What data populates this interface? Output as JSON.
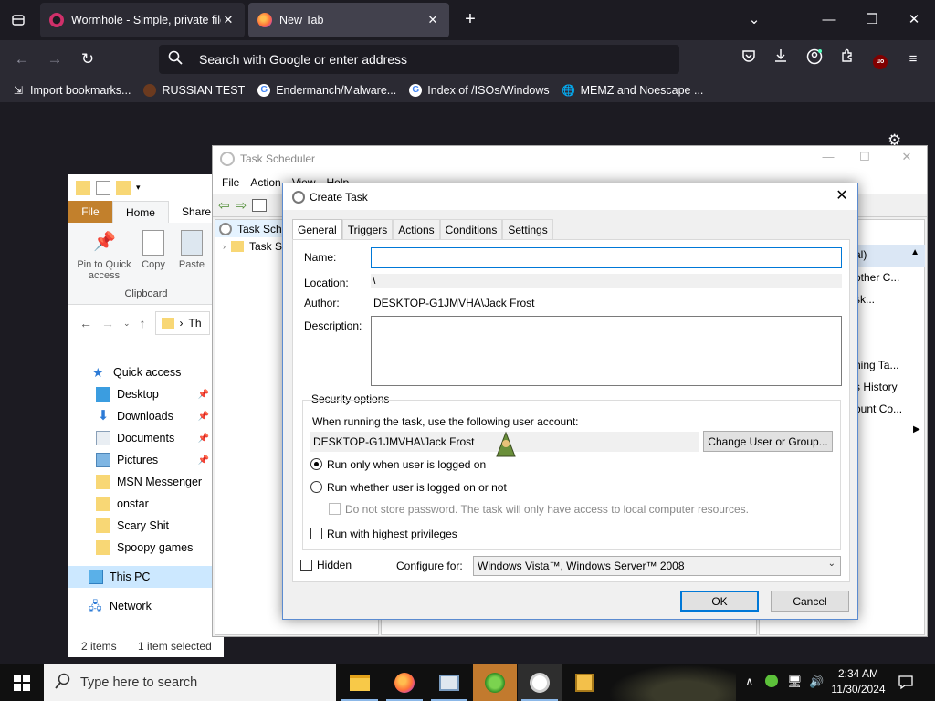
{
  "browser": {
    "tabs": [
      {
        "title": "Wormhole - Simple, private file",
        "active": false
      },
      {
        "title": "New Tab",
        "active": true
      }
    ],
    "urlbar_placeholder": "Search with Google or enter address",
    "bookmarks": [
      {
        "label": "Import bookmarks...",
        "icon": "import-icon"
      },
      {
        "label": "RUSSIAN TEST",
        "icon": "russian-test-icon"
      },
      {
        "label": "Endermanch/Malware...",
        "icon": "google-icon"
      },
      {
        "label": "Index of /ISOs/Windows",
        "icon": "google-icon"
      },
      {
        "label": "MEMZ and Noescape ...",
        "icon": "globe-icon"
      }
    ],
    "colors": {
      "tabbar": "#1c1b22",
      "toolbar": "#2b2a33",
      "active_tab": "#42414d"
    }
  },
  "explorer": {
    "ribbon_tabs": [
      "File",
      "Home",
      "Share"
    ],
    "ribbon_buttons": [
      {
        "label": "Pin to Quick access"
      },
      {
        "label": "Copy"
      },
      {
        "label": "Paste"
      }
    ],
    "ribbon_group": "Clipboard",
    "address_crumb": "Th",
    "nav": [
      {
        "label": "Quick access",
        "pinned": false
      },
      {
        "label": "Desktop",
        "pinned": true
      },
      {
        "label": "Downloads",
        "pinned": true
      },
      {
        "label": "Documents",
        "pinned": true
      },
      {
        "label": "Pictures",
        "pinned": true
      },
      {
        "label": "MSN Messenger",
        "pinned": false
      },
      {
        "label": "onstar",
        "pinned": false
      },
      {
        "label": "Scary Shit",
        "pinned": false
      },
      {
        "label": "Spoopy games",
        "pinned": false
      },
      {
        "label": "This PC",
        "pinned": false
      },
      {
        "label": "Network",
        "pinned": false
      }
    ],
    "status_items": "2 items",
    "status_selected": "1 item selected"
  },
  "task_scheduler": {
    "title": "Task Scheduler",
    "menu": [
      "File",
      "Action",
      "View",
      "Help"
    ],
    "tree": [
      "Task Sche",
      "Task S"
    ],
    "actions_partial": [
      "al)",
      "other C...",
      "sk...",
      "ning Ta...",
      "s History",
      "ount Co..."
    ]
  },
  "create_task": {
    "title": "Create Task",
    "tabs": [
      "General",
      "Triggers",
      "Actions",
      "Conditions",
      "Settings"
    ],
    "name_label": "Name:",
    "name_value": "",
    "location_label": "Location:",
    "location_value": "\\",
    "author_label": "Author:",
    "author_value": "DESKTOP-G1JMVHA\\Jack Frost",
    "description_label": "Description:",
    "description_value": "",
    "security": {
      "legend": "Security options",
      "account_prompt": "When running the task, use the following user account:",
      "account_value": "DESKTOP-G1JMVHA\\Jack Frost",
      "change_button": "Change User or Group...",
      "radio_logged_on": "Run only when user is logged on",
      "radio_whether": "Run whether user is logged on or not",
      "no_store_password": "Do not store password.  The task will only have access to local computer resources.",
      "highest_privileges": "Run with highest privileges",
      "selected_option": "Run only when user is logged on"
    },
    "hidden_label": "Hidden",
    "configure_label": "Configure for:",
    "configure_value": "Windows Vista™, Windows Server™ 2008",
    "ok_button": "OK",
    "cancel_button": "Cancel"
  },
  "taskbar": {
    "search_placeholder": "Type here to search",
    "apps": [
      "file-explorer",
      "firefox",
      "task-manager",
      "msn-messenger",
      "task-scheduler",
      "floppy-save"
    ],
    "clock_time": "2:34 AM",
    "clock_date": "11/30/2024"
  }
}
